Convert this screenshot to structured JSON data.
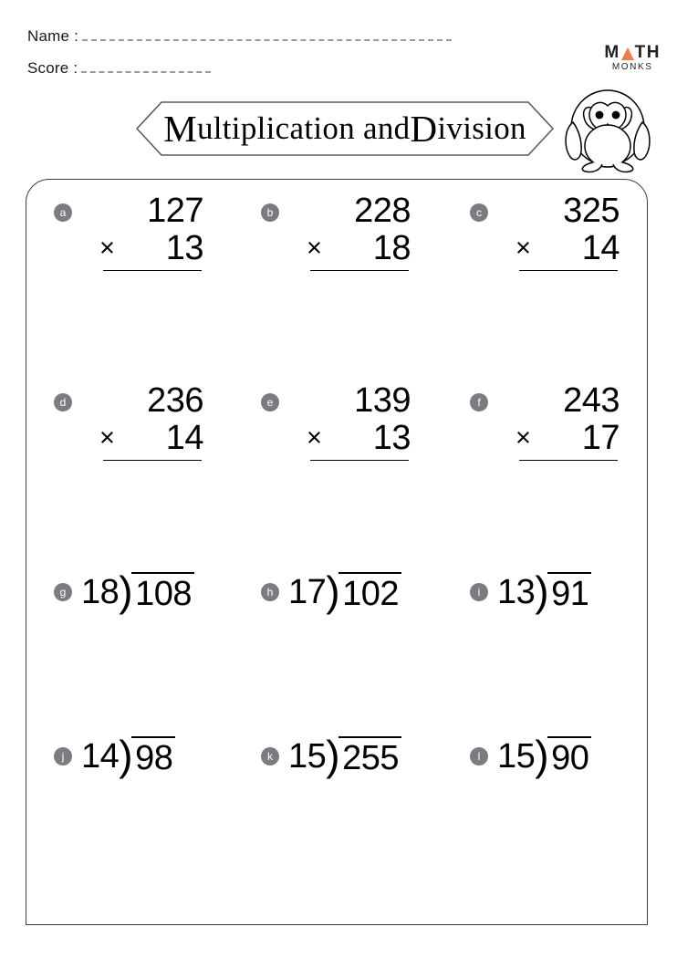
{
  "header": {
    "name_label": "Name :",
    "score_label": "Score :",
    "logo": {
      "brand_primary_left": "M",
      "brand_primary_right": "TH",
      "brand_secondary": "MONKS",
      "triangle_color": "#ee7b4d",
      "triangle_icon": "triangle-icon"
    },
    "mascot_icon": "penguin-icon"
  },
  "title": {
    "cap1": "M",
    "part1": "ultiplication and ",
    "cap2": "D",
    "part2": "ivision",
    "full": "Multiplication and Division"
  },
  "problems": {
    "multiplication": [
      {
        "letter": "a",
        "top": "127",
        "operator": "×",
        "bottom": "13"
      },
      {
        "letter": "b",
        "top": "228",
        "operator": "×",
        "bottom": "18"
      },
      {
        "letter": "c",
        "top": "325",
        "operator": "×",
        "bottom": "14"
      },
      {
        "letter": "d",
        "top": "236",
        "operator": "×",
        "bottom": "14"
      },
      {
        "letter": "e",
        "top": "139",
        "operator": "×",
        "bottom": "13"
      },
      {
        "letter": "f",
        "top": "243",
        "operator": "×",
        "bottom": "17"
      }
    ],
    "division": [
      {
        "letter": "g",
        "divisor": "18",
        "bracket": ")",
        "dividend": "108"
      },
      {
        "letter": "h",
        "divisor": "17",
        "bracket": ")",
        "dividend": "102"
      },
      {
        "letter": "i",
        "divisor": "13",
        "bracket": ")",
        "dividend": "91"
      },
      {
        "letter": "j",
        "divisor": "14",
        "bracket": ")",
        "dividend": "98"
      },
      {
        "letter": "k",
        "divisor": "15",
        "bracket": ")",
        "dividend": "255"
      },
      {
        "letter": "l",
        "divisor": "15",
        "bracket": ")",
        "dividend": "90"
      }
    ]
  },
  "colors": {
    "badge_background": "#7c7c80",
    "badge_text": "#ffffff",
    "rule_line": "#000000",
    "dashed_line": "#9a9a9a",
    "box_border": "#3f3f46",
    "accent": "#ee7b4d"
  }
}
